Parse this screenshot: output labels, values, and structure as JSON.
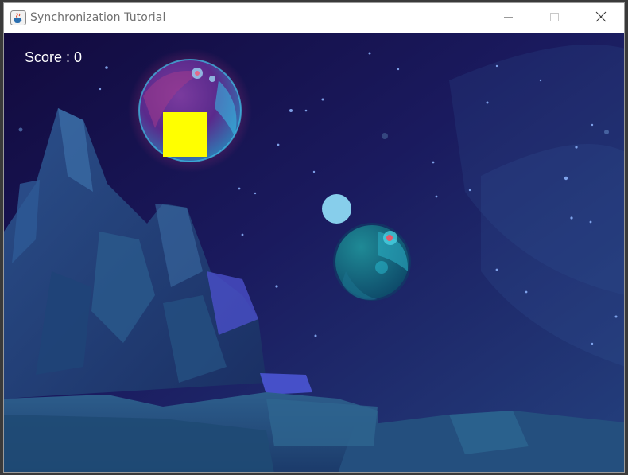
{
  "window": {
    "title": "Synchronization Tutorial",
    "icon": "java-cup-icon",
    "controls": [
      "minimize-icon",
      "maximize-icon",
      "close-icon"
    ]
  },
  "game": {
    "score_text": "Score : 0",
    "player_color": "#ffff00",
    "ball_color": "#87ceeb",
    "background": "space-scene-with-planets-and-mountains"
  }
}
